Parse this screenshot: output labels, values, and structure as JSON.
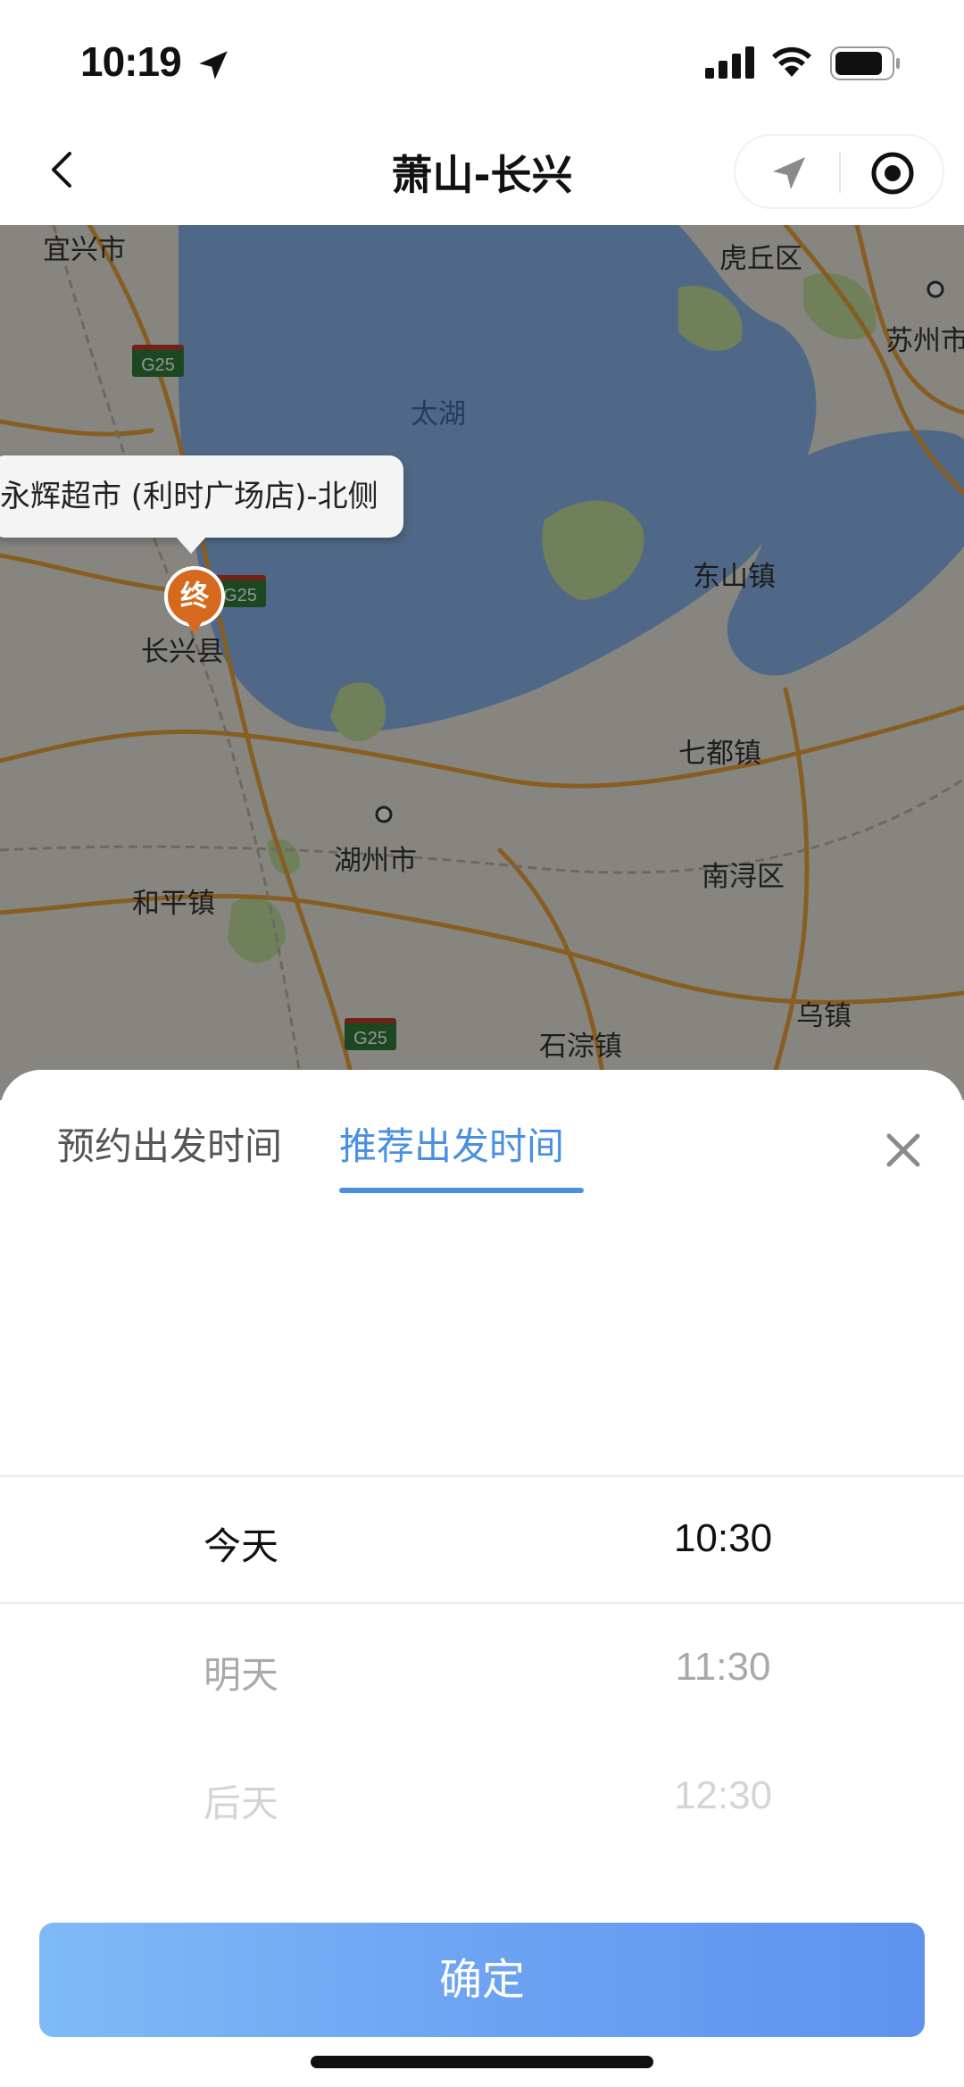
{
  "status_bar": {
    "time": "10:19"
  },
  "nav": {
    "title": "萧山-长兴"
  },
  "map": {
    "labels": {
      "yixing": "宜兴市",
      "huqiu": "虎丘区",
      "suzhou": "苏州市",
      "taihu": "太湖",
      "dongshan": "东山镇",
      "changxing": "长兴县",
      "qidu": "七都镇",
      "huzhou": "湖州市",
      "nanxun": "南浔区",
      "heping": "和平镇",
      "wuzhen": "乌镇",
      "shicong": "石淙镇"
    },
    "highway": "G25",
    "destination_callout": "永辉超市 (利时广场店)-北侧",
    "end_marker": "终"
  },
  "sheet": {
    "tabs": [
      {
        "label": "预约出发时间",
        "active": false
      },
      {
        "label": "推荐出发时间",
        "active": true
      }
    ],
    "picker": {
      "days": [
        "今天",
        "明天",
        "后天"
      ],
      "times": [
        "10:30",
        "11:30",
        "12:30"
      ]
    },
    "confirm_label": "确定"
  },
  "colors": {
    "accent": "#4a90e2",
    "end_marker": "#d56a1f"
  }
}
